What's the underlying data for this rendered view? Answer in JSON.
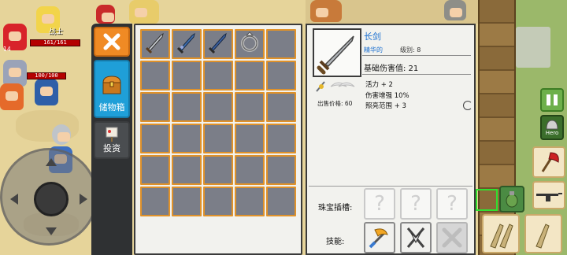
{
  "world": {
    "heroes": [
      {
        "name_tag": "战士",
        "hp": "161/161",
        "level": "14"
      },
      {
        "hp": "100/100"
      }
    ],
    "hero_button_label": "Hero"
  },
  "tabs": {
    "close_icon": "close-x-icon",
    "storage_label": "储物箱",
    "invest_label": "投资"
  },
  "inventory": {
    "slots": [
      {
        "item": "sword",
        "color": "#9aa0a6"
      },
      {
        "item": "blue-sword",
        "color": "#3d6fb0"
      },
      {
        "item": "blue-sword-2",
        "color": "#3a5fa0"
      },
      {
        "item": "ring",
        "color": "#b8b8b8"
      },
      {
        "item": ""
      },
      {
        "item": ""
      },
      {
        "item": ""
      },
      {
        "item": ""
      },
      {
        "item": ""
      },
      {
        "item": ""
      },
      {
        "item": ""
      },
      {
        "item": ""
      },
      {
        "item": ""
      },
      {
        "item": ""
      },
      {
        "item": ""
      },
      {
        "item": ""
      },
      {
        "item": ""
      },
      {
        "item": ""
      },
      {
        "item": ""
      },
      {
        "item": ""
      },
      {
        "item": ""
      },
      {
        "item": ""
      },
      {
        "item": ""
      },
      {
        "item": ""
      },
      {
        "item": ""
      },
      {
        "item": ""
      },
      {
        "item": ""
      },
      {
        "item": ""
      },
      {
        "item": ""
      },
      {
        "item": ""
      }
    ]
  },
  "detail": {
    "name": "长剑",
    "quality": "精华的",
    "level_text": "级别: 8",
    "base_damage": "基础伤害值: 21",
    "stats": [
      "活力 + 2",
      "伤害增强 10%",
      "照亮范围 + 3"
    ],
    "sell_price": "出售价格: 60",
    "socket_label": "珠宝插槽:",
    "skill_label": "技能:",
    "sockets": [
      "?",
      "?",
      "?"
    ],
    "skills": [
      "axe-sword-skill",
      "crossed-swords-skill",
      "locked-skill"
    ]
  }
}
